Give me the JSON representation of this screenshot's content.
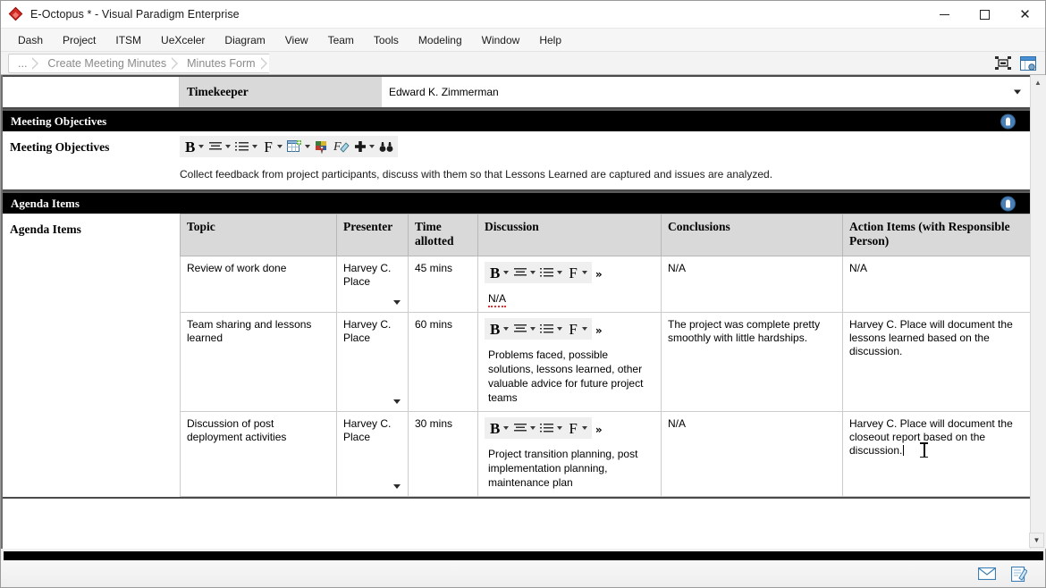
{
  "window": {
    "title": "E-Octopus * - Visual Paradigm Enterprise",
    "logo_icon": "vp-diamond-icon",
    "minimize_label": "—",
    "maximize_label": "☐",
    "close_label": "✕"
  },
  "menubar": {
    "items": [
      {
        "label": "Dash"
      },
      {
        "label": "Project"
      },
      {
        "label": "ITSM"
      },
      {
        "label": "UeXceler"
      },
      {
        "label": "Diagram"
      },
      {
        "label": "View"
      },
      {
        "label": "Team"
      },
      {
        "label": "Tools"
      },
      {
        "label": "Modeling"
      },
      {
        "label": "Window"
      },
      {
        "label": "Help"
      }
    ]
  },
  "breadcrumb": {
    "items": [
      {
        "label": "..."
      },
      {
        "label": "Create Meeting Minutes"
      },
      {
        "label": "Minutes Form"
      }
    ],
    "right_icons": [
      {
        "name": "fit-to-screen-icon"
      },
      {
        "name": "open-form-window-icon"
      }
    ]
  },
  "form": {
    "timekeeper": {
      "label": "Timekeeper",
      "value": "Edward K. Zimmerman"
    },
    "meeting_objectives": {
      "section_title": "Meeting Objectives",
      "field_label": "Meeting Objectives",
      "text": "Collect feedback from project participants, discuss with them so that Lessons Learned are captured and issues are analyzed.",
      "toolbar": [
        {
          "name": "bold-icon",
          "glyph": "B",
          "caret": true
        },
        {
          "name": "align-icon",
          "glyph": "≡",
          "caret": true
        },
        {
          "name": "list-icon",
          "glyph": "≣",
          "caret": true
        },
        {
          "name": "font-icon",
          "glyph": "F",
          "caret": true
        },
        {
          "name": "insert-table-icon",
          "glyph": "▦",
          "caret": true
        },
        {
          "name": "color-palette-icon",
          "glyph": "▣",
          "caret": false
        },
        {
          "name": "format-painter-icon",
          "glyph": "F",
          "caret": false
        },
        {
          "name": "insert-icon",
          "glyph": "＋",
          "caret": true
        },
        {
          "name": "find-icon",
          "glyph": "♋",
          "caret": false
        }
      ]
    },
    "agenda": {
      "section_title": "Agenda Items",
      "field_label": "Agenda Items",
      "columns": [
        "Topic",
        "Presenter",
        "Time allotted",
        "Discussion",
        "Conclusions",
        "Action Items (with Responsible Person)"
      ],
      "mini_toolbar": [
        {
          "name": "bold-icon",
          "glyph": "B",
          "caret": true
        },
        {
          "name": "align-icon",
          "glyph": "≡",
          "caret": true
        },
        {
          "name": "list-icon",
          "glyph": "≣",
          "caret": true
        },
        {
          "name": "font-icon",
          "glyph": "F",
          "caret": true
        }
      ],
      "overflow_label": "»",
      "rows": [
        {
          "topic": "Review of work done",
          "presenter": "Harvey C. Place",
          "time": "45 mins",
          "discussion": "N/A",
          "discussion_misspelled": true,
          "conclusions": "N/A",
          "action_items": "N/A",
          "caret_in_action": false
        },
        {
          "topic": "Team sharing and lessons learned",
          "presenter": "Harvey C. Place",
          "time": "60 mins",
          "discussion": "Problems faced, possible solutions, lessons learned, other valuable advice for future project teams",
          "discussion_misspelled": false,
          "conclusions": "The project was complete pretty smoothly with little hardships.",
          "action_items": "Harvey C. Place will document the lessons learned based on the discussion.",
          "caret_in_action": false
        },
        {
          "topic": "Discussion of post deployment activities",
          "presenter": "Harvey C. Place",
          "time": "30 mins",
          "discussion": "Project transition planning, post implementation planning, maintenance plan",
          "discussion_misspelled": false,
          "conclusions": "N/A",
          "action_items": "Harvey C. Place will document the closeout report based on the discussion.",
          "caret_in_action": true
        }
      ]
    }
  },
  "statusbar": {
    "icons": [
      {
        "name": "mail-icon"
      },
      {
        "name": "edit-note-icon"
      }
    ]
  },
  "scrollbar": {
    "up_label": "▲",
    "down_label": "▼"
  },
  "colors": {
    "section_bar_bg": "#000000",
    "header_cell_bg": "#d9d9d9",
    "badge_blue": "#4a7fb5",
    "spell_error": "#dd3333"
  }
}
